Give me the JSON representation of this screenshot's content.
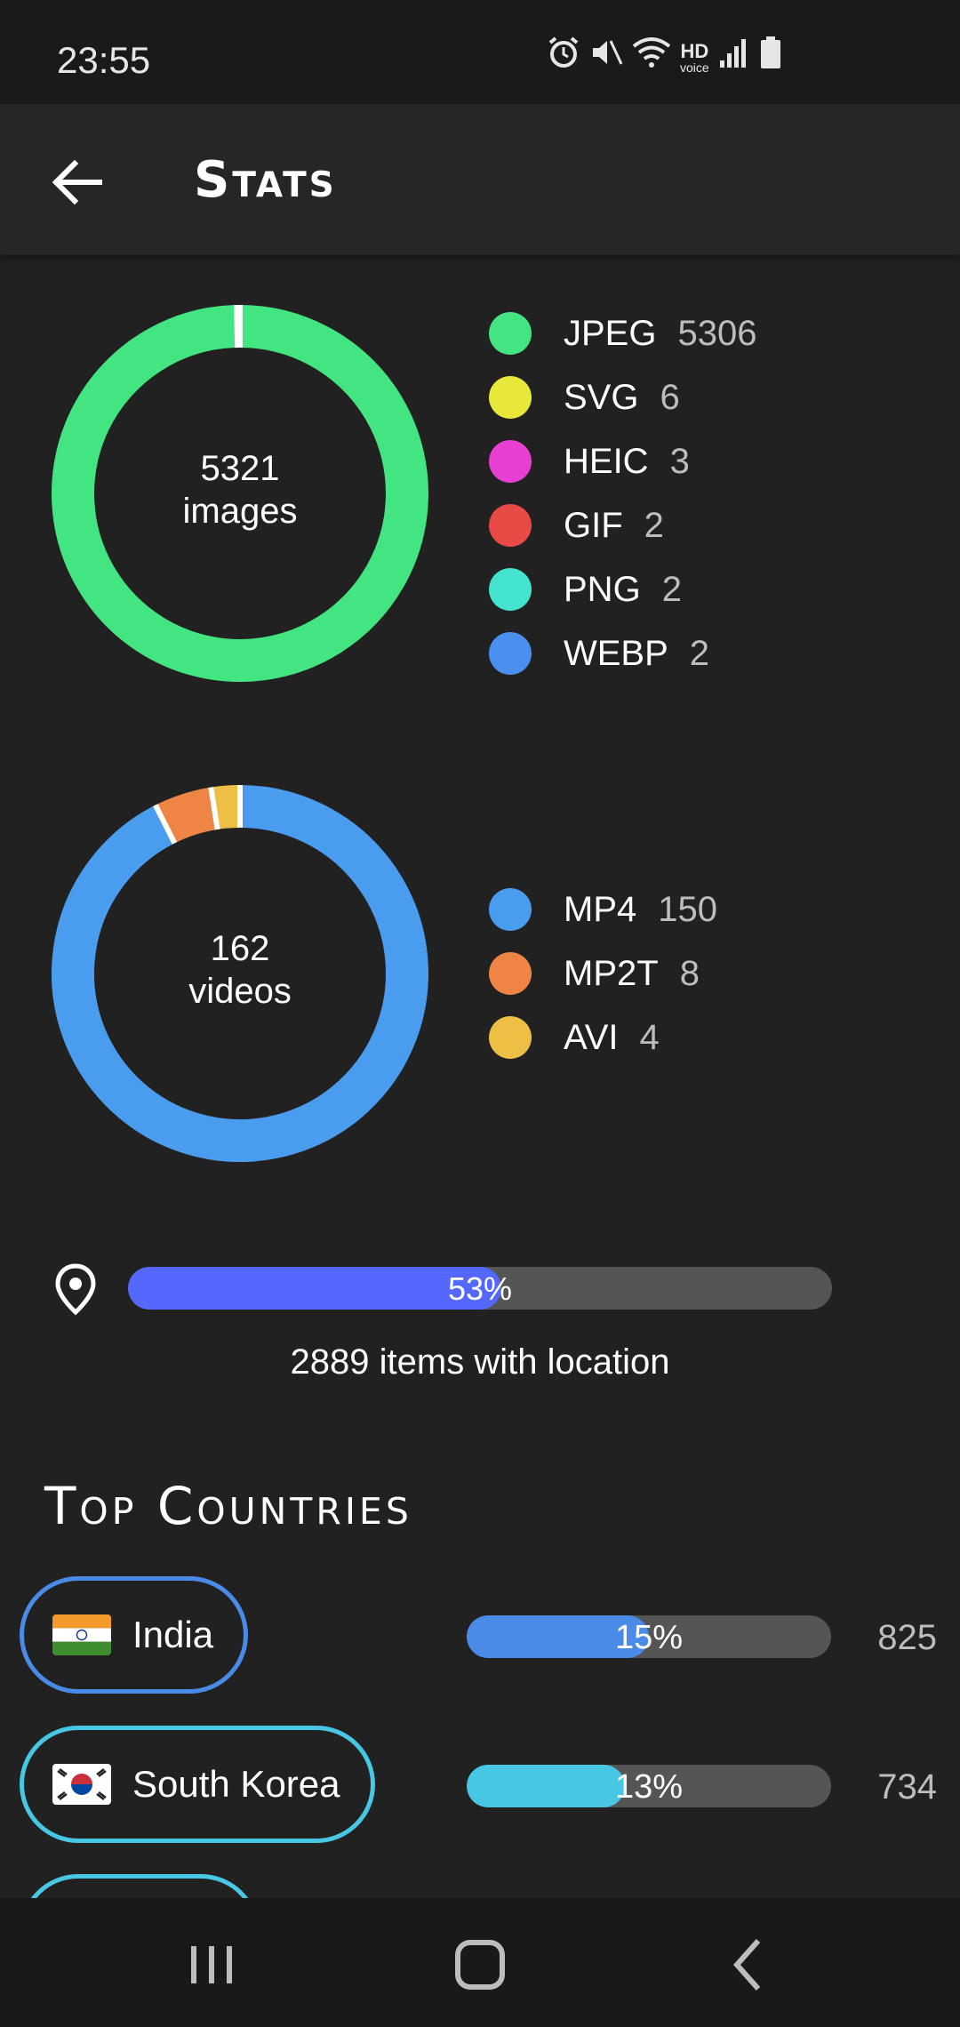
{
  "status_bar": {
    "time": "23:55",
    "icons": [
      "alarm-icon",
      "mute-icon",
      "wifi-icon",
      "hd-voice-icon",
      "signal-icon",
      "battery-icon"
    ],
    "hd_top": "HD",
    "hd_bottom": "voice"
  },
  "header": {
    "title": "Stats",
    "back_icon": "arrow-left-icon"
  },
  "images": {
    "total": "5321",
    "unit": "images",
    "legend": [
      {
        "label": "JPEG",
        "count": "5306",
        "value": 5306,
        "color": "#43e581"
      },
      {
        "label": "SVG",
        "count": "6",
        "value": 6,
        "color": "#e8e83a"
      },
      {
        "label": "HEIC",
        "count": "3",
        "value": 3,
        "color": "#e63fd1"
      },
      {
        "label": "GIF",
        "count": "2",
        "value": 2,
        "color": "#e84b45"
      },
      {
        "label": "PNG",
        "count": "2",
        "value": 2,
        "color": "#43e3cf"
      },
      {
        "label": "WEBP",
        "count": "2",
        "value": 2,
        "color": "#4a8ff0"
      }
    ]
  },
  "videos": {
    "total": "162",
    "unit": "videos",
    "legend": [
      {
        "label": "MP4",
        "count": "150",
        "value": 150,
        "color": "#4a9cee"
      },
      {
        "label": "MP2T",
        "count": "8",
        "value": 8,
        "color": "#ee8545"
      },
      {
        "label": "AVI",
        "count": "4",
        "value": 4,
        "color": "#edbf45"
      }
    ]
  },
  "location": {
    "percent_label": "53%",
    "fraction": 0.53,
    "caption": "2889 items with location",
    "fill_color": "#5468ff"
  },
  "top_countries": {
    "title": "Top Countries",
    "items": [
      {
        "name": "India",
        "percent_label": "15%",
        "fraction": 0.15,
        "count": "825",
        "color": "#4a8be8",
        "flag": "india-flag-icon"
      },
      {
        "name": "South Korea",
        "percent_label": "13%",
        "fraction": 0.13,
        "count": "734",
        "color": "#48c7e5",
        "flag": "south-korea-flag-icon"
      }
    ]
  },
  "nav": {
    "recents": "recents-icon",
    "home": "home-icon",
    "back": "back-icon"
  }
}
